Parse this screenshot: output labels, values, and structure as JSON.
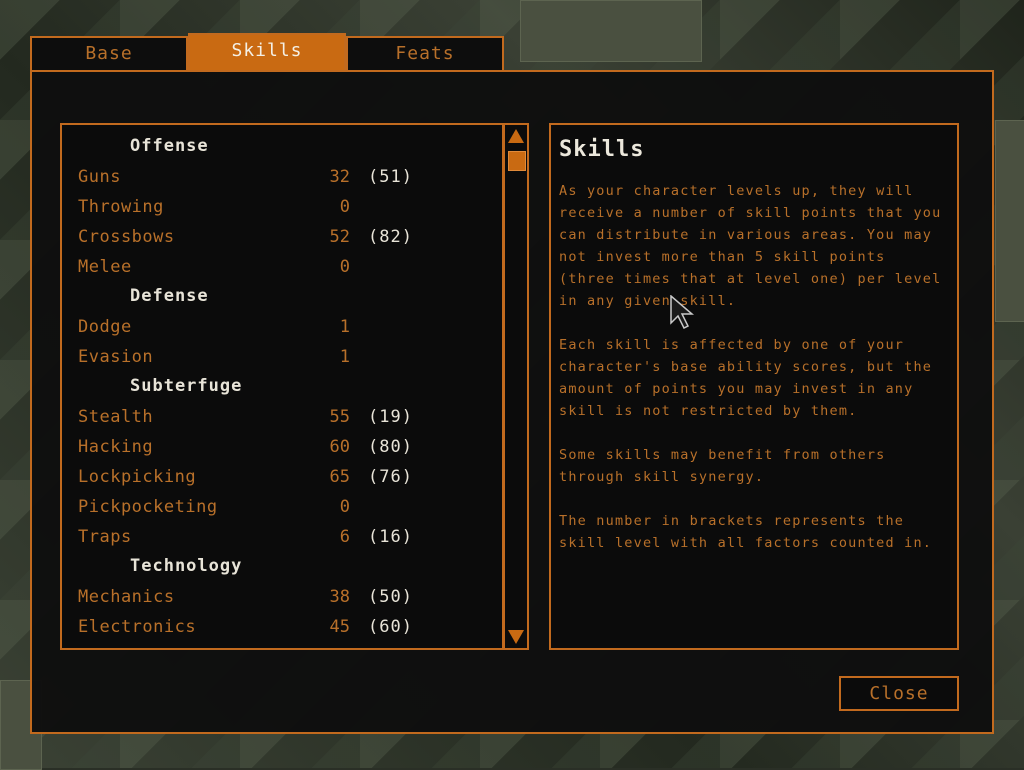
{
  "tabs": [
    {
      "label": "Base"
    },
    {
      "label": "Skills"
    },
    {
      "label": "Feats"
    }
  ],
  "skills_list": [
    {
      "type": "heading",
      "label": "Offense"
    },
    {
      "type": "skill",
      "name": "Guns",
      "value": "32",
      "effective": "(51)"
    },
    {
      "type": "skill",
      "name": "Throwing",
      "value": "0",
      "effective": ""
    },
    {
      "type": "skill",
      "name": "Crossbows",
      "value": "52",
      "effective": "(82)"
    },
    {
      "type": "skill",
      "name": "Melee",
      "value": "0",
      "effective": ""
    },
    {
      "type": "heading",
      "label": "Defense"
    },
    {
      "type": "skill",
      "name": "Dodge",
      "value": "1",
      "effective": ""
    },
    {
      "type": "skill",
      "name": "Evasion",
      "value": "1",
      "effective": ""
    },
    {
      "type": "heading",
      "label": "Subterfuge"
    },
    {
      "type": "skill",
      "name": "Stealth",
      "value": "55",
      "effective": "(19)"
    },
    {
      "type": "skill",
      "name": "Hacking",
      "value": "60",
      "effective": "(80)"
    },
    {
      "type": "skill",
      "name": "Lockpicking",
      "value": "65",
      "effective": "(76)"
    },
    {
      "type": "skill",
      "name": "Pickpocketing",
      "value": "0",
      "effective": ""
    },
    {
      "type": "skill",
      "name": "Traps",
      "value": "6",
      "effective": "(16)"
    },
    {
      "type": "heading",
      "label": "Technology"
    },
    {
      "type": "skill",
      "name": "Mechanics",
      "value": "38",
      "effective": "(50)"
    },
    {
      "type": "skill",
      "name": "Electronics",
      "value": "45",
      "effective": "(60)"
    }
  ],
  "description": {
    "title": "Skills",
    "paragraphs": [
      "As your character levels up, they will receive a number of skill points that you can distribute in various areas. You may not invest more than 5 skill points (three times that at level one) per level in any given skill.",
      "Each skill is affected by one of your character's base ability scores, but the amount of points you may invest in any skill is not restricted by them.",
      "Some skills may benefit from others through skill synergy.",
      "The number in brackets represents the skill level with all factors counted in."
    ]
  },
  "close_label": "Close",
  "colors": {
    "accent": "#c96a12",
    "text_orange": "#b8702a",
    "text_light": "#e8e4d8",
    "panel": "#0b0b0b"
  },
  "icons": {
    "scroll_up": "triangle-up-icon",
    "scroll_down": "triangle-down-icon",
    "cursor": "mouse-pointer-icon"
  }
}
